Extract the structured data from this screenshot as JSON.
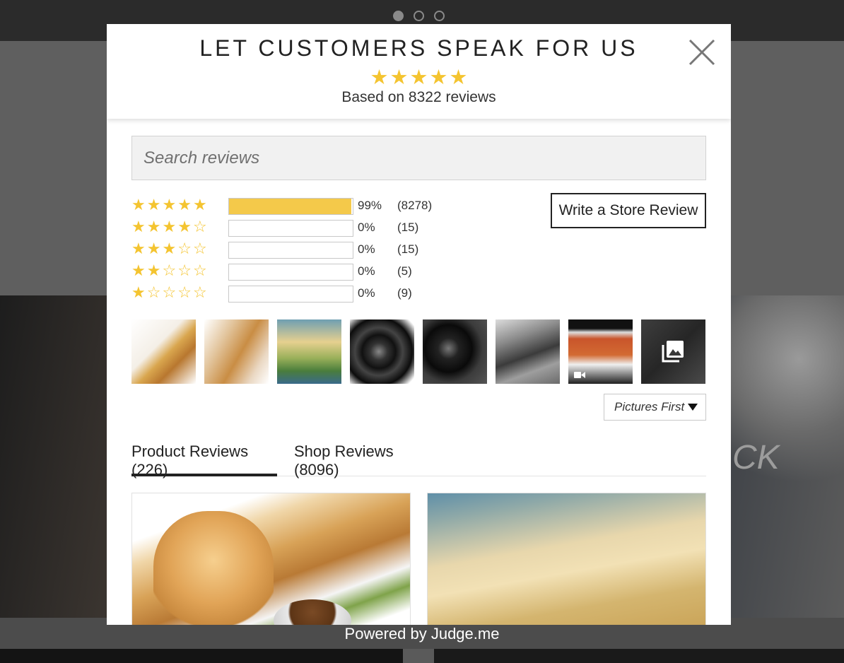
{
  "background": {
    "slider_dots": [
      true,
      false,
      false
    ],
    "overlay_text": "CK",
    "powered_by": "Powered by Judge.me"
  },
  "modal": {
    "title": "LET CUSTOMERS SPEAK FOR US",
    "average_rating": 5,
    "summary": "Based on 8322 reviews",
    "close_icon": "close-icon",
    "search": {
      "placeholder": "Search reviews"
    },
    "histogram": [
      {
        "stars": 5,
        "percent": 99,
        "percent_label": "99%",
        "count_label": "(8278)"
      },
      {
        "stars": 4,
        "percent": 0,
        "percent_label": "0%",
        "count_label": "(15)"
      },
      {
        "stars": 3,
        "percent": 0,
        "percent_label": "0%",
        "count_label": "(15)"
      },
      {
        "stars": 2,
        "percent": 0,
        "percent_label": "0%",
        "count_label": "(5)"
      },
      {
        "stars": 1,
        "percent": 0,
        "percent_label": "0%",
        "count_label": "(9)"
      }
    ],
    "write_review_label": "Write a Store Review",
    "thumbnails": [
      {
        "name": "dog-food-photo"
      },
      {
        "name": "dog-with-person-photo"
      },
      {
        "name": "sunset-landscape-photo"
      },
      {
        "name": "car-wheel-photo"
      },
      {
        "name": "car-wheel-closeup-photo"
      },
      {
        "name": "car-interior-cleaning-photo"
      },
      {
        "name": "garage-video-thumbnail",
        "icon": "video-icon"
      },
      {
        "name": "more-photos-thumbnail",
        "icon": "gallery-icon"
      }
    ],
    "sort": {
      "selected": "Pictures First"
    },
    "tabs": [
      {
        "label": "Product Reviews (226)",
        "active": true
      },
      {
        "label": "Shop Reviews (8096)",
        "active": false
      }
    ],
    "colors": {
      "star": "#f4c430",
      "bar_fill": "#f4c94a"
    }
  }
}
